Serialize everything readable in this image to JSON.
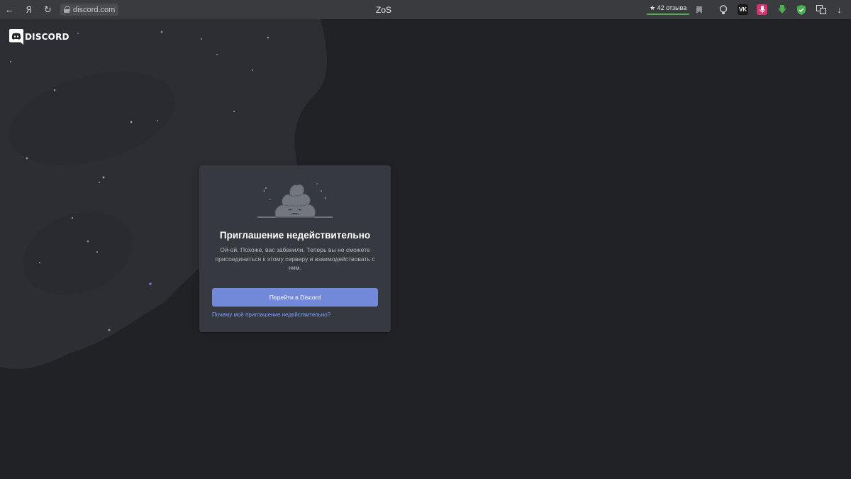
{
  "browser": {
    "back_icon": "←",
    "yandex_label": "Я",
    "reload_icon": "↻",
    "url": "discord.com",
    "tab_title": "ZoS",
    "reviews_label": "★ 42 отзыва",
    "download_icon": "↓"
  },
  "page": {
    "logo_text": "DISCORD",
    "card": {
      "title": "Приглашение недействительно",
      "description": "Ой-ой. Похоже, вас забанили. Теперь вы не сможете присоединиться к этому серверу и взаимодействовать с ним.",
      "button_label": "Перейти в Discord",
      "help_link": "Почему моё приглашение недействительно?"
    }
  },
  "colors": {
    "background": "#202225",
    "card": "#36393f",
    "button": "#7289da",
    "link": "#7ba0ff"
  }
}
